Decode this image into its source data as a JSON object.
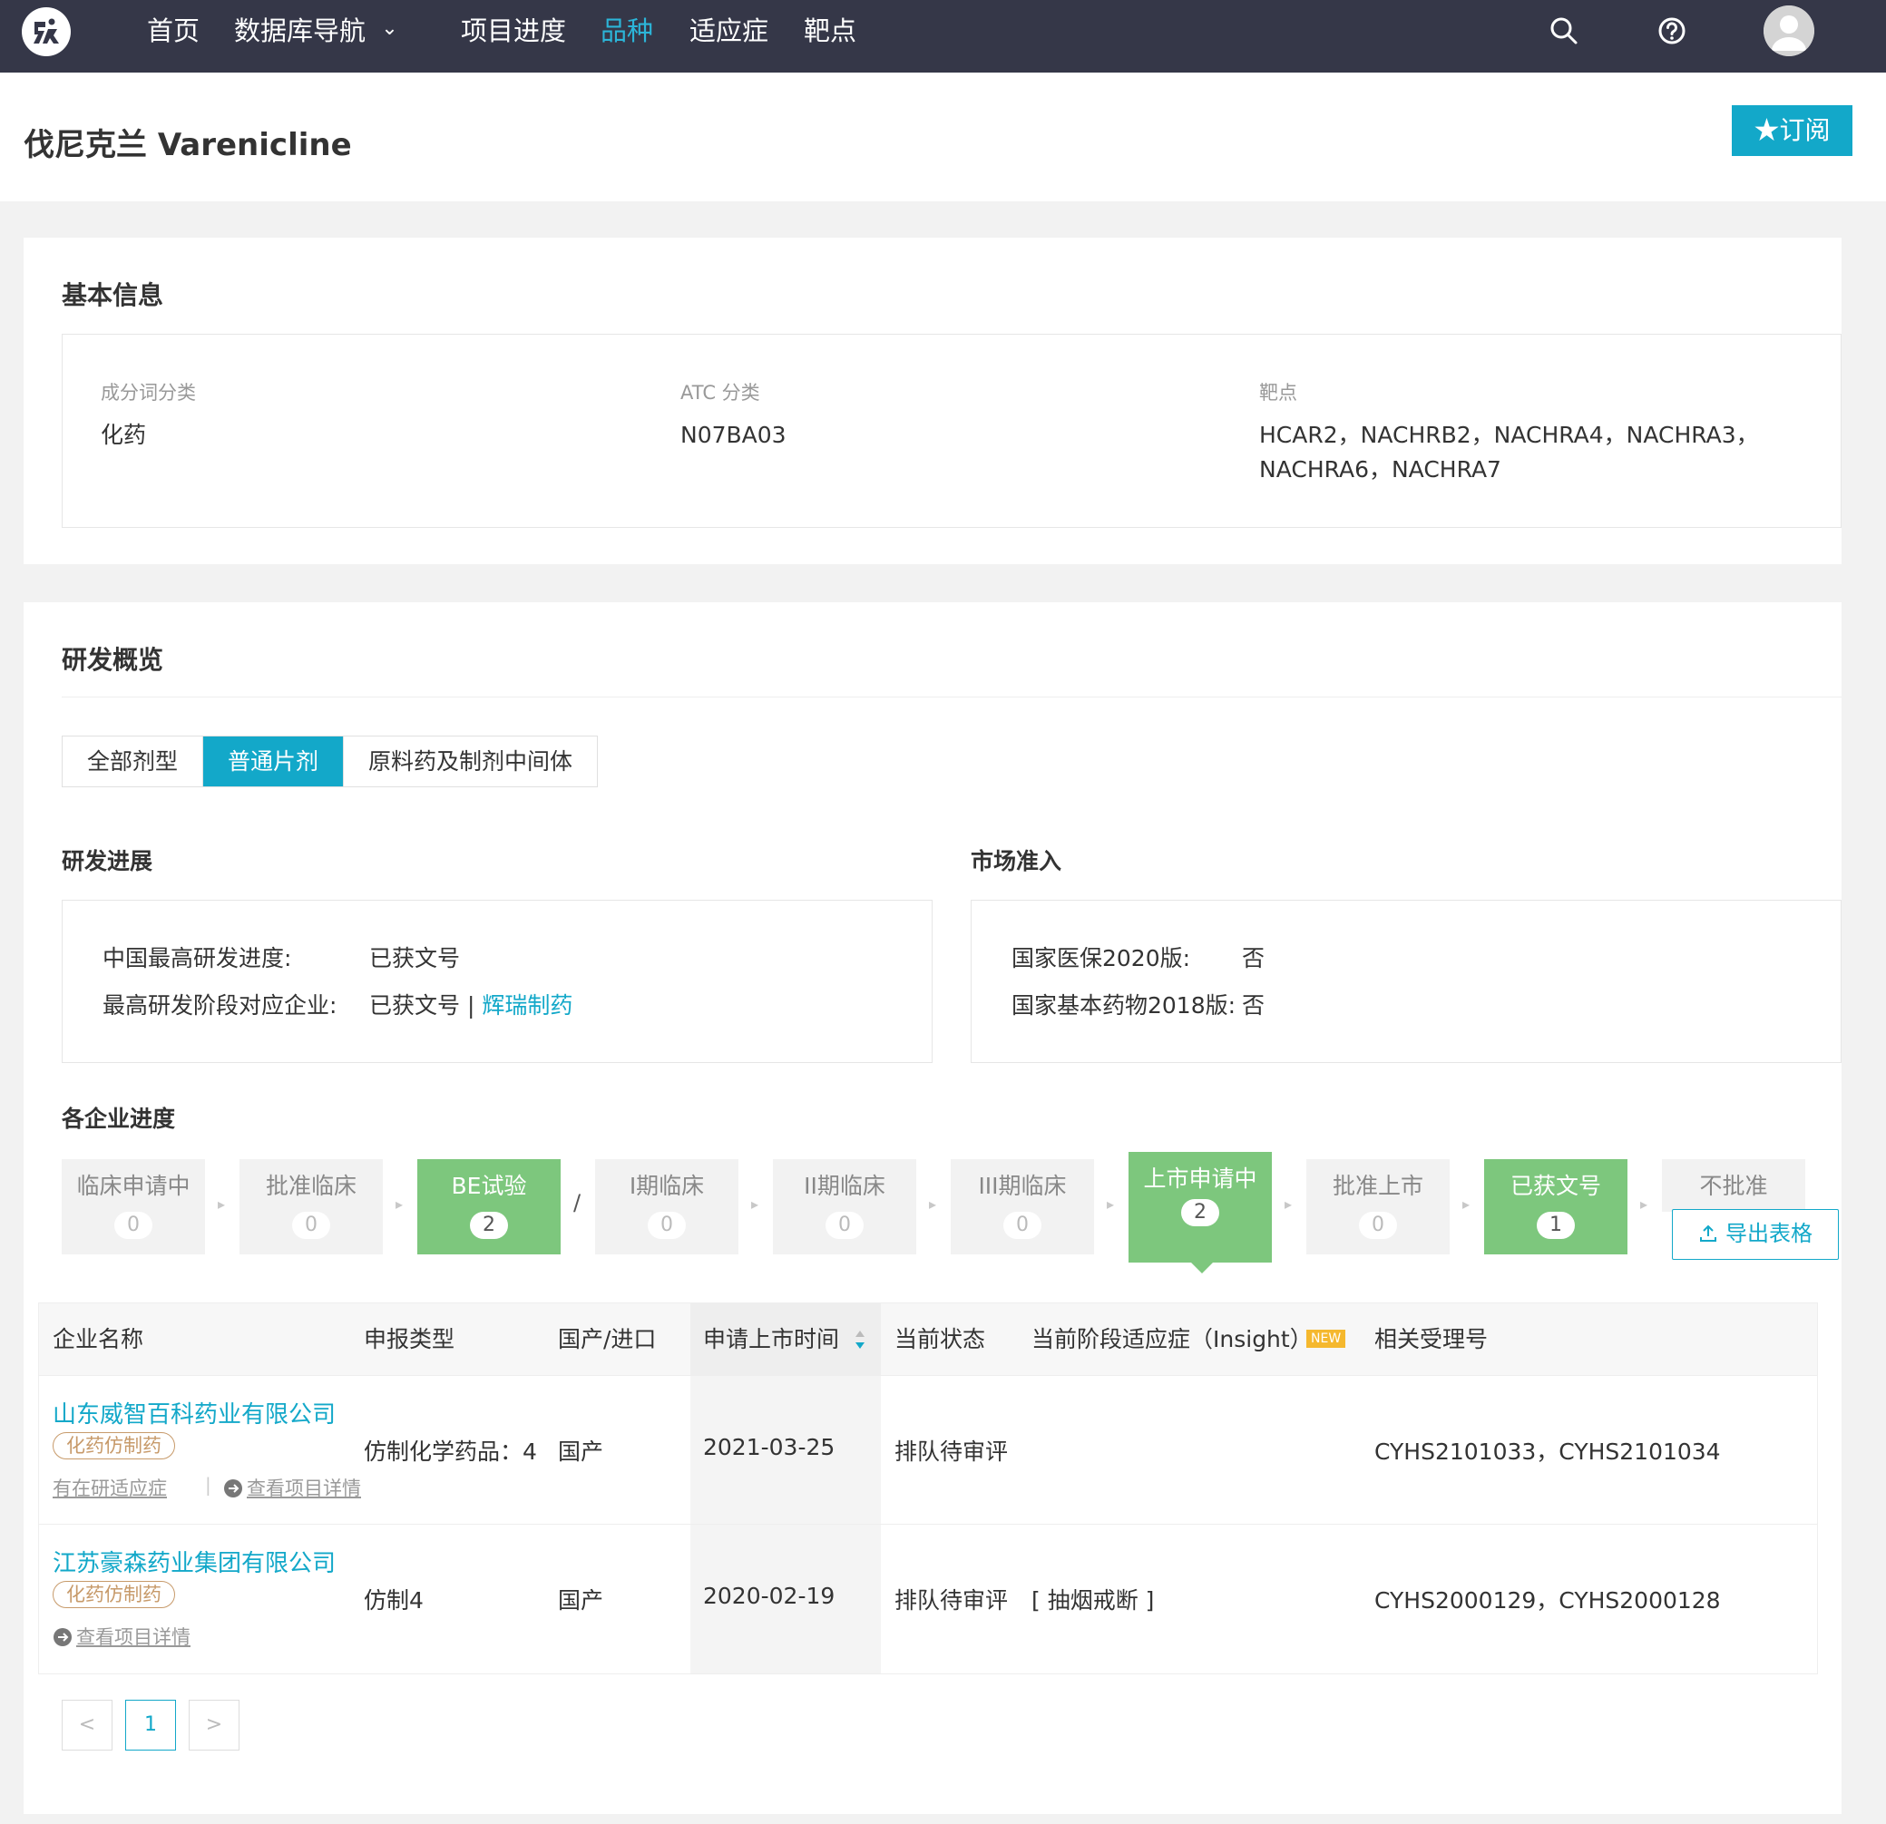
{
  "nav": {
    "items": [
      {
        "label": "首页"
      },
      {
        "label": "数据库导航"
      },
      {
        "label": "项目进度"
      },
      {
        "label": "品种"
      },
      {
        "label": "适应症"
      },
      {
        "label": "靶点"
      }
    ],
    "active_index": 3,
    "dropdown_chevron": "⌄",
    "icons": [
      "search-icon",
      "help-icon",
      "avatar-icon"
    ]
  },
  "page": {
    "title": "伐尼克兰 Varenicline",
    "subscribe_label": "★订阅"
  },
  "basic_info": {
    "title": "基本信息",
    "fields": [
      {
        "label": "成分词分类",
        "value": "化药"
      },
      {
        "label": "ATC 分类",
        "value": "N07BA03"
      },
      {
        "label": "靶点",
        "value_line1": "HCAR2，NACHRB2，NACHRA4，NACHRA3，",
        "value_line2": "NACHRA6，NACHRA7"
      }
    ]
  },
  "rd_overview": {
    "title": "研发概览",
    "tabs": [
      "全部剂型",
      "普通片剂",
      "原料药及制剂中间体"
    ],
    "active_tab": 1,
    "progress": {
      "title": "研发进展",
      "rows": [
        {
          "label": "中国最高研发进度:",
          "value": "已获文号"
        },
        {
          "label": "最高研发阶段对应企业:",
          "value": "已获文号 | ",
          "link": "辉瑞制药"
        }
      ]
    },
    "market": {
      "title": "市场准入",
      "rows": [
        {
          "label": "国家医保2020版:",
          "value": "否"
        },
        {
          "label": "国家基本药物2018版:",
          "value": "否"
        }
      ]
    },
    "company_progress": {
      "title": "各企业进度",
      "stages": [
        {
          "label": "临床申请中",
          "count": "0",
          "highlight": false
        },
        {
          "label": "批准临床",
          "count": "0",
          "highlight": false
        },
        {
          "label": "BE试验",
          "count": "2",
          "highlight": true
        },
        {
          "label": "I期临床",
          "count": "0",
          "highlight": false
        },
        {
          "label": "II期临床",
          "count": "0",
          "highlight": false
        },
        {
          "label": "III期临床",
          "count": "0",
          "highlight": false
        },
        {
          "label": "上市申请中",
          "count": "2",
          "highlight": true
        },
        {
          "label": "批准上市",
          "count": "0",
          "highlight": false
        },
        {
          "label": "已获文号",
          "count": "1",
          "highlight": true
        },
        {
          "label": "不批准",
          "count": "",
          "highlight": false
        }
      ],
      "selected_stage": 6,
      "separator_slash": "/",
      "separator_arrow": "▸",
      "export_label": "导出表格"
    },
    "table": {
      "headers": [
        "企业名称",
        "申报类型",
        "国产/进口",
        "申请上市时间",
        "当前状态",
        "当前阶段适应症（Insight）",
        "相关受理号"
      ],
      "new_badge": "NEW",
      "sorted_column": "申请上市时间",
      "rows": [
        {
          "company": "山东威智百科药业有限公司",
          "tag": "化药仿制药",
          "sub_link_1": "有在研适应症",
          "sub_divider": "|",
          "sub_link_2": "查看项目详情",
          "type": "仿制化学药品：4",
          "origin": "国产",
          "date": "2021-03-25",
          "status": "排队待审评",
          "indication": "",
          "accept_nos": "CYHS2101033，CYHS2101034"
        },
        {
          "company": "江苏豪森药业集团有限公司",
          "tag": "化药仿制药",
          "sub_link_2": "查看项目详情",
          "type": "仿制4",
          "origin": "国产",
          "date": "2020-02-19",
          "status": "排队待审评",
          "indication": "[ 抽烟戒断 ]",
          "accept_nos": "CYHS2000129，CYHS2000128"
        }
      ]
    },
    "pagination": {
      "prev": "<",
      "current": "1",
      "next": ">"
    }
  },
  "colors": {
    "nav_bg": "#353748",
    "accent": "#13a8c9",
    "stage_green": "#7dc77d",
    "tag_brown": "#c79a6a",
    "new_badge": "#f5b82e"
  }
}
